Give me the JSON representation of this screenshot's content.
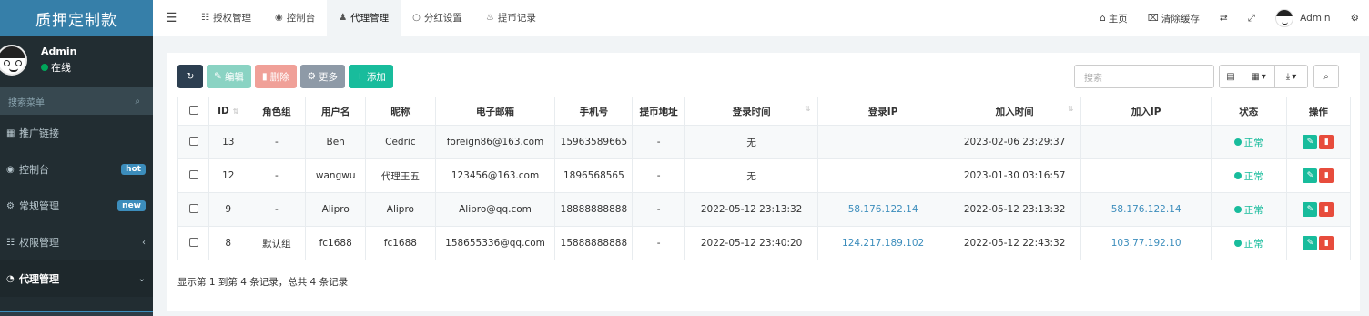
{
  "sidebar": {
    "logo": "质押定制款",
    "user": {
      "name": "Admin",
      "status": "在线"
    },
    "search_placeholder": "搜索菜单",
    "items": [
      {
        "label": "推广链接",
        "icon": "qrcode-icon",
        "glyph": "▦"
      },
      {
        "label": "控制台",
        "icon": "dashboard-icon",
        "glyph": "◉",
        "badge": "hot"
      },
      {
        "label": "常规管理",
        "icon": "cogs-icon",
        "glyph": "⚙",
        "badge": "new"
      },
      {
        "label": "权限管理",
        "icon": "group-icon",
        "glyph": "☷",
        "chevron": "‹"
      },
      {
        "label": "代理管理",
        "icon": "user-circle-icon",
        "glyph": "◔",
        "chevron": "⌄"
      }
    ]
  },
  "topbar": {
    "tabs": [
      {
        "label": "授权管理",
        "glyph": "☷"
      },
      {
        "label": "控制台",
        "glyph": "◉"
      },
      {
        "label": "代理管理",
        "glyph": "♟"
      },
      {
        "label": "分红设置",
        "glyph": "○"
      },
      {
        "label": "提币记录",
        "glyph": "♨"
      }
    ],
    "right": {
      "home": "主页",
      "clear_cache": "清除缓存",
      "user": "Admin"
    }
  },
  "toolbar": {
    "edit": "编辑",
    "delete": "删除",
    "more": "更多",
    "add": "添加",
    "search_placeholder": "搜索"
  },
  "table": {
    "headers": [
      "ID",
      "角色组",
      "用户名",
      "昵称",
      "电子邮箱",
      "手机号",
      "提币地址",
      "登录时间",
      "登录IP",
      "加入时间",
      "加入IP",
      "状态",
      "操作"
    ],
    "rows": [
      {
        "id": "13",
        "group": "-",
        "username": "Ben",
        "nickname": "Cedric",
        "email": "foreign86@163.com",
        "phone": "15963589665",
        "address": "-",
        "login_time": "无",
        "login_ip": "",
        "join_time": "2023-02-06 23:29:37",
        "join_ip": "",
        "status": "正常"
      },
      {
        "id": "12",
        "group": "-",
        "username": "wangwu",
        "nickname": "代理王五",
        "email": "123456@163.com",
        "phone": "1896568565",
        "address": "-",
        "login_time": "无",
        "login_ip": "",
        "join_time": "2023-01-30 03:16:57",
        "join_ip": "",
        "status": "正常"
      },
      {
        "id": "9",
        "group": "-",
        "username": "Alipro",
        "nickname": "Alipro",
        "email": "Alipro@qq.com",
        "phone": "18888888888",
        "address": "-",
        "login_time": "2022-05-12 23:13:32",
        "login_ip": "58.176.122.14",
        "join_time": "2022-05-12 23:13:32",
        "join_ip": "58.176.122.14",
        "status": "正常"
      },
      {
        "id": "8",
        "group": "默认组",
        "username": "fc1688",
        "nickname": "fc1688",
        "email": "158655336@qq.com",
        "phone": "15888888888",
        "address": "-",
        "login_time": "2022-05-12 23:40:20",
        "login_ip": "124.217.189.102",
        "join_time": "2022-05-12 22:43:32",
        "join_ip": "103.77.192.10",
        "status": "正常"
      }
    ]
  },
  "footer": "显示第 1 到第 4 条记录，总共 4 条记录"
}
